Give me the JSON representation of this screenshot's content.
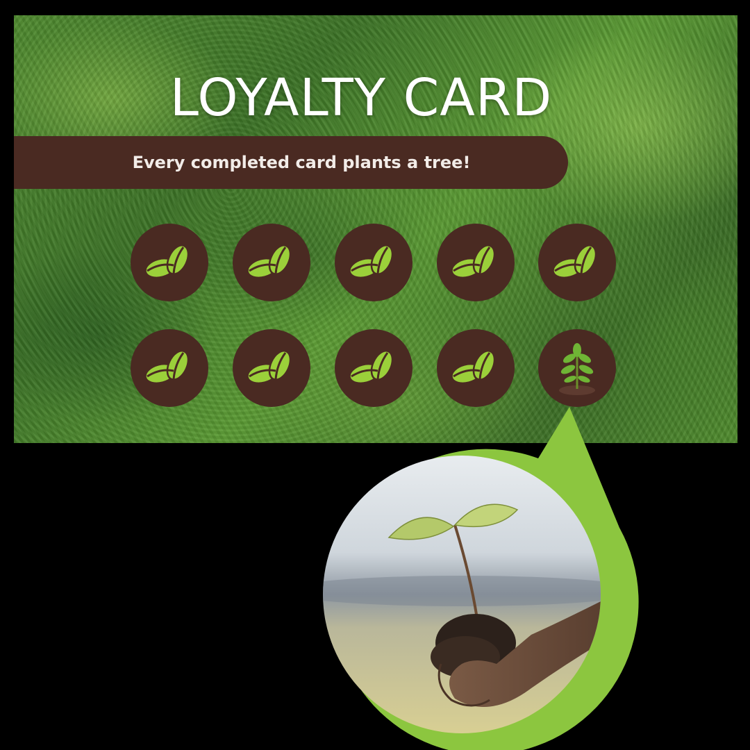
{
  "card": {
    "title": "LOYALTY CARD",
    "banner_text": "Every completed card plants a tree!"
  },
  "stamps": [
    {
      "icon": "coffee-beans-icon"
    },
    {
      "icon": "coffee-beans-icon"
    },
    {
      "icon": "coffee-beans-icon"
    },
    {
      "icon": "coffee-beans-icon"
    },
    {
      "icon": "coffee-beans-icon"
    },
    {
      "icon": "coffee-beans-icon"
    },
    {
      "icon": "coffee-beans-icon"
    },
    {
      "icon": "coffee-beans-icon"
    },
    {
      "icon": "coffee-beans-icon"
    },
    {
      "icon": "sapling-icon"
    }
  ],
  "colors": {
    "stamp_brown": "#4a2a22",
    "bean_green": "#9bd03a",
    "accent_green": "#8cc63f"
  }
}
